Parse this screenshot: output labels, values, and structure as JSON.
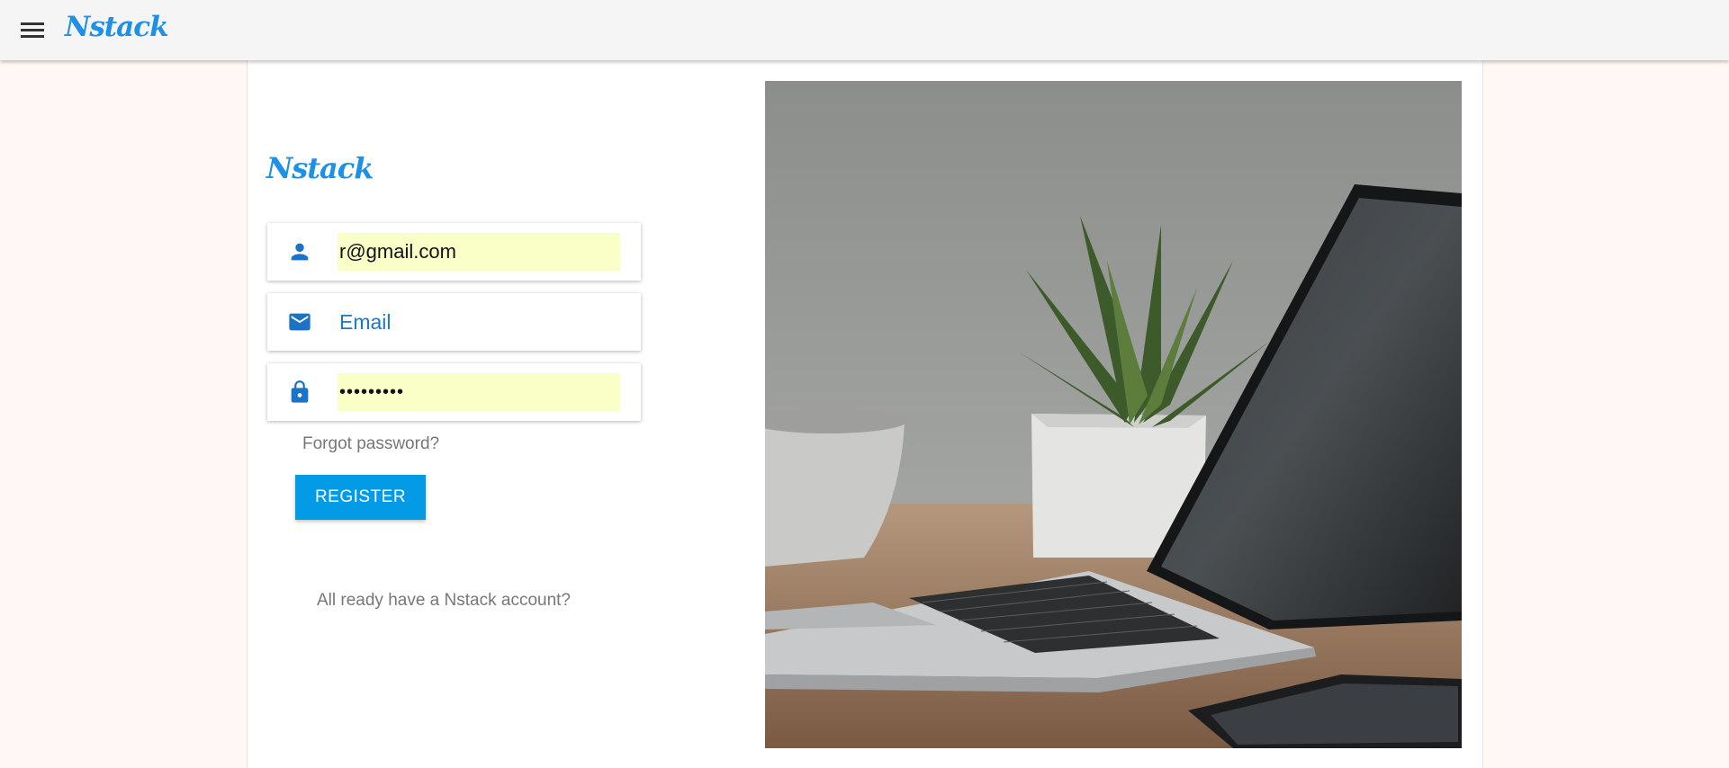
{
  "appbar": {
    "brand": "Nstack",
    "menu_icon": "menu-icon"
  },
  "form": {
    "logo": "Nstack",
    "username": {
      "icon": "person-icon",
      "value": "r@gmail.com"
    },
    "email": {
      "icon": "email-icon",
      "placeholder": "Email"
    },
    "password": {
      "icon": "lock-icon",
      "value": "•••••••••"
    },
    "forgot_link": "Forgot password?",
    "register_button": "REGISTER",
    "have_account_link": "All ready have a Nstack account?"
  },
  "colors": {
    "brand": "#1e90e6",
    "button": "#039be5",
    "autofill": "#faffc7",
    "background": "#fff8f4"
  }
}
